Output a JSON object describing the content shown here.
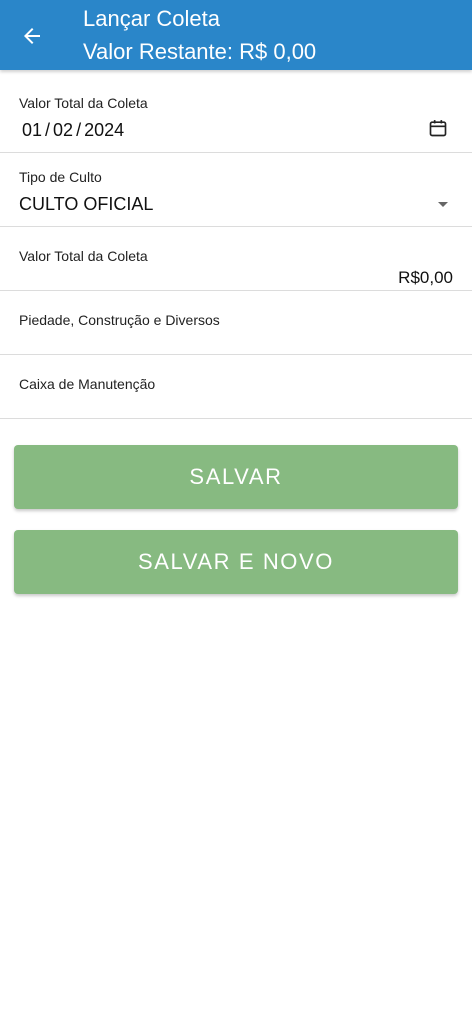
{
  "header": {
    "title": "Lançar Coleta",
    "subtitle": "Valor Restante: R$ 0,00",
    "back_icon": "arrow-left-icon",
    "background_color": "#2a86c9"
  },
  "form": {
    "date_field": {
      "label": "Valor Total da Coleta",
      "day": "01",
      "month": "02",
      "year": "2024",
      "separator": "/",
      "icon": "calendar-icon"
    },
    "culto_field": {
      "label": "Tipo de Culto",
      "value": "CULTO OFICIAL",
      "icon": "dropdown-arrow-icon"
    },
    "total_field": {
      "label": "Valor Total da Coleta",
      "value": "R$0,00"
    },
    "piedade_field": {
      "label": "Piedade, Construção e Diversos",
      "value": ""
    },
    "caixa_field": {
      "label": "Caixa de Manutenção",
      "value": ""
    }
  },
  "actions": {
    "save_label": "SALVAR",
    "save_new_label": "SALVAR E NOVO",
    "button_color": "#87ba81"
  }
}
